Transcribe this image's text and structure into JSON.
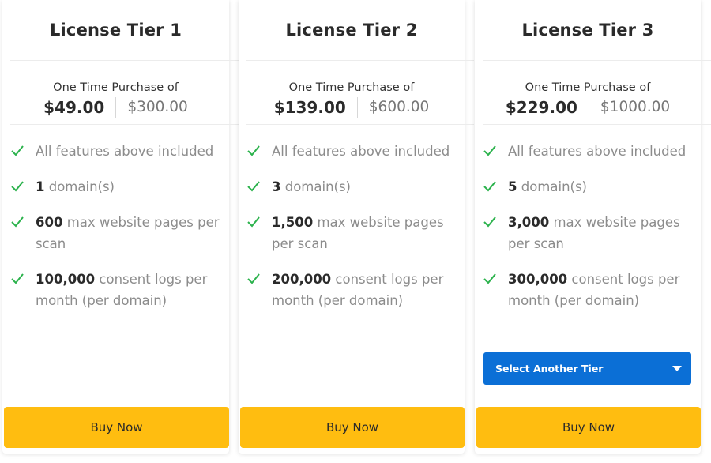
{
  "tiers": [
    {
      "title": "License Tier 1",
      "purchase_label": "One Time Purchase of",
      "price": "$49.00",
      "old_price": "$300.00",
      "features": [
        {
          "highlight": "",
          "text": "All features above included"
        },
        {
          "highlight": "1",
          "text": " domain(s)"
        },
        {
          "highlight": "600",
          "text": " max website pages per scan"
        },
        {
          "highlight": "100,000",
          "text": " consent logs per month (per domain)"
        }
      ],
      "buy_label": "Buy Now"
    },
    {
      "title": "License Tier 2",
      "purchase_label": "One Time Purchase of",
      "price": "$139.00",
      "old_price": "$600.00",
      "features": [
        {
          "highlight": "",
          "text": "All features above included"
        },
        {
          "highlight": "3",
          "text": " domain(s)"
        },
        {
          "highlight": "1,500",
          "text": " max website pages per scan"
        },
        {
          "highlight": "200,000",
          "text": " consent logs per month (per domain)"
        }
      ],
      "buy_label": "Buy Now"
    },
    {
      "title": "License Tier 3",
      "purchase_label": "One Time Purchase of",
      "price": "$229.00",
      "old_price": "$1000.00",
      "features": [
        {
          "highlight": "",
          "text": "All features above included"
        },
        {
          "highlight": "5",
          "text": " domain(s)"
        },
        {
          "highlight": "3,000",
          "text": " max website pages per scan"
        },
        {
          "highlight": "300,000",
          "text": " consent logs per month (per domain)"
        }
      ],
      "select_label": "Select Another Tier",
      "buy_label": "Buy Now"
    }
  ],
  "colors": {
    "accent_buy": "#ffbd10",
    "accent_select": "#0b6fd6",
    "check": "#2bb24c"
  },
  "icons": {
    "feature": "check-icon",
    "dropdown": "caret-down-icon"
  }
}
